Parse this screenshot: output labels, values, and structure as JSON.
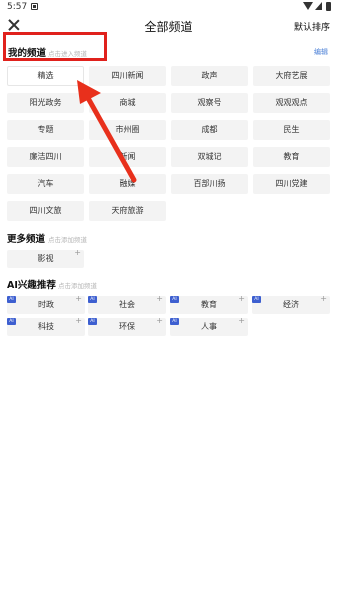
{
  "status_bar": {
    "time": "5:57"
  },
  "header": {
    "title": "全部频道",
    "sort_label": "默认排序"
  },
  "my_channels": {
    "title": "我的频道",
    "hint": "点击进入频道",
    "edit": "编辑",
    "items": [
      "精选",
      "四川新闻",
      "政声",
      "大府艺展",
      "阳光政务",
      "商城",
      "观察号",
      "观观观点",
      "专题",
      "市州圈",
      "成都",
      "民生",
      "廉洁四川",
      "新闻",
      "双城记",
      "教育",
      "汽车",
      "融媒",
      "百部川扬",
      "四川党建",
      "四川文旅",
      "天府旅游"
    ]
  },
  "more_channels": {
    "title": "更多频道",
    "hint": "点击添加频道",
    "items": [
      "影视"
    ]
  },
  "ai_channels": {
    "title": "AI兴趣推荐",
    "hint": "点击添加频道",
    "ai_label": "AI",
    "plus": "+",
    "items": [
      "时政",
      "社会",
      "教育",
      "经济",
      "科技",
      "环保",
      "人事"
    ]
  },
  "colors": {
    "highlight": "#e0211c",
    "arrow": "#e8301c",
    "link": "#4a7fd6",
    "ai_tag": "#3d5fd0"
  }
}
